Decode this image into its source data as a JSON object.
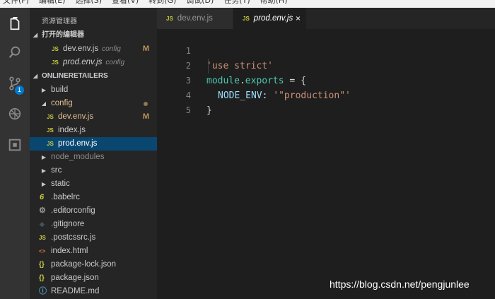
{
  "menubar": [
    "文件(F)",
    "编辑(E)",
    "选择(S)",
    "查看(V)",
    "转到(G)",
    "调试(D)",
    "任务(T)",
    "帮助(H)"
  ],
  "activity": {
    "scm_badge": "1"
  },
  "sidebar": {
    "title": "资源管理器",
    "open_editors_header": "打开的编辑器",
    "open_editors": [
      {
        "icon": "JS",
        "name": "dev.env.js",
        "desc": "config",
        "mark": "M"
      },
      {
        "icon": "JS",
        "name": "prod.env.js",
        "desc": "config",
        "mark": ""
      }
    ],
    "project_header": "ONLINERETAILERS",
    "tree": [
      {
        "twisty": "▶",
        "name": "build"
      },
      {
        "twisty": "◢",
        "name": "config"
      },
      {
        "icon": "JS",
        "name": "dev.env.js",
        "mark": "M"
      },
      {
        "icon": "JS",
        "name": "index.js"
      },
      {
        "icon": "JS",
        "name": "prod.env.js"
      },
      {
        "twisty": "▶",
        "name": "node_modules"
      },
      {
        "twisty": "▶",
        "name": "src"
      },
      {
        "twisty": "▶",
        "name": "static"
      },
      {
        "icon": "6",
        "name": ".babelrc"
      },
      {
        "icon": "⚙",
        "name": ".editorconfig"
      },
      {
        "icon": "◆",
        "name": ".gitignore"
      },
      {
        "icon": "JS",
        "name": ".postcssrc.js"
      },
      {
        "icon": "<>",
        "name": "index.html"
      },
      {
        "icon": "{}",
        "name": "package-lock.json"
      },
      {
        "icon": "{}",
        "name": "package.json"
      },
      {
        "icon": "ⓘ",
        "name": "README.md"
      }
    ]
  },
  "tabs": [
    {
      "icon": "JS",
      "label": "dev.env.js"
    },
    {
      "icon": "JS",
      "label": "prod.env.js",
      "close": "×"
    }
  ],
  "editor": {
    "line_numbers": [
      "1",
      "2",
      "3",
      "4",
      "5"
    ],
    "code": {
      "l1": "'use strict'",
      "l2_a": "module",
      "l2_b": ".",
      "l2_c": "exports",
      "l2_d": " = {",
      "l3_key": "NODE_ENV",
      "l3_colon": ": ",
      "l3_val": "'\"production\"'",
      "l4": "}"
    }
  },
  "watermark": "https://blog.csdn.net/pengjunlee",
  "colors": {
    "activity_bar": "#333333",
    "sidebar": "#252526",
    "editor": "#1e1e1e",
    "selection": "#094771",
    "badge": "#007acc",
    "string": "#ce9178",
    "js_icon": "#cbcb41"
  }
}
